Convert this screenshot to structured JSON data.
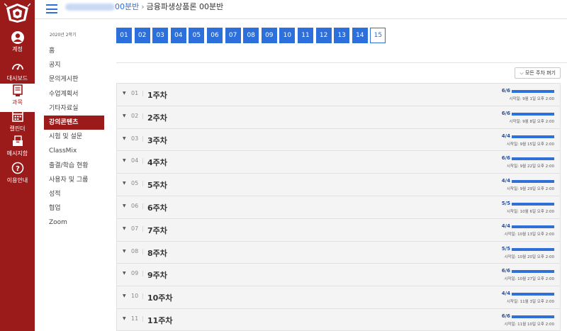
{
  "header": {
    "breadcrumb_course": "00분반",
    "breadcrumb_separator": "›",
    "breadcrumb_page": "금융파생상품론 00분반"
  },
  "global_nav": {
    "items": [
      {
        "label": "계정",
        "icon": "account-icon"
      },
      {
        "label": "대시보드",
        "icon": "dashboard-icon"
      },
      {
        "label": "과목",
        "icon": "courses-icon",
        "active": true
      },
      {
        "label": "캘린더",
        "icon": "calendar-icon"
      },
      {
        "label": "메시지함",
        "icon": "inbox-icon"
      },
      {
        "label": "이용안내",
        "icon": "help-icon"
      }
    ],
    "brand_color": "#9b1b1b"
  },
  "course_nav": {
    "term": "2020년 2학기",
    "items": [
      {
        "label": "홈"
      },
      {
        "label": "공지"
      },
      {
        "label": "문의게시판"
      },
      {
        "label": "수업계획서"
      },
      {
        "label": "기타자료실"
      },
      {
        "label": "강의콘텐츠",
        "active": true
      },
      {
        "label": "시험 및 설문"
      },
      {
        "label": "ClassMix"
      },
      {
        "label": "출결/학습 현황"
      },
      {
        "label": "사용자 및 그룹"
      },
      {
        "label": "성적"
      },
      {
        "label": "협업"
      },
      {
        "label": "Zoom"
      }
    ]
  },
  "pages": {
    "items": [
      "01",
      "02",
      "03",
      "04",
      "05",
      "06",
      "07",
      "08",
      "09",
      "10",
      "11",
      "12",
      "13",
      "14",
      "15"
    ],
    "current": "15",
    "accent": "#2d6fdb"
  },
  "collapse_all_label": "모든 주차 펴기",
  "weeks": [
    {
      "num": "01",
      "title": "1주차",
      "count": "6/6",
      "progress": 1.0,
      "date": "시작일: 9월 1일 오후 2:00"
    },
    {
      "num": "02",
      "title": "2주차",
      "count": "6/6",
      "progress": 1.0,
      "date": "시작일: 9월 8일 오후 2:00"
    },
    {
      "num": "03",
      "title": "3주차",
      "count": "4/4",
      "progress": 1.0,
      "date": "시작일: 9월 15일 오후 2:00"
    },
    {
      "num": "04",
      "title": "4주차",
      "count": "6/6",
      "progress": 1.0,
      "date": "시작일: 9월 22일 오후 2:00"
    },
    {
      "num": "05",
      "title": "5주차",
      "count": "4/4",
      "progress": 1.0,
      "date": "시작일: 9월 29일 오후 2:00"
    },
    {
      "num": "06",
      "title": "6주차",
      "count": "5/5",
      "progress": 1.0,
      "date": "시작일: 10월 6일 오후 2:00"
    },
    {
      "num": "07",
      "title": "7주차",
      "count": "4/4",
      "progress": 1.0,
      "date": "시작일: 10월 13일 오후 2:00"
    },
    {
      "num": "08",
      "title": "8주차",
      "count": "5/5",
      "progress": 1.0,
      "date": "시작일: 10월 20일 오후 2:00"
    },
    {
      "num": "09",
      "title": "9주차",
      "count": "6/6",
      "progress": 1.0,
      "date": "시작일: 10월 27일 오후 2:00"
    },
    {
      "num": "10",
      "title": "10주차",
      "count": "4/4",
      "progress": 1.0,
      "date": "시작일: 11월 3일 오후 2:00"
    },
    {
      "num": "11",
      "title": "11주차",
      "count": "6/6",
      "progress": 1.0,
      "date": "시작일: 11월 10일 오후 2:00"
    }
  ]
}
